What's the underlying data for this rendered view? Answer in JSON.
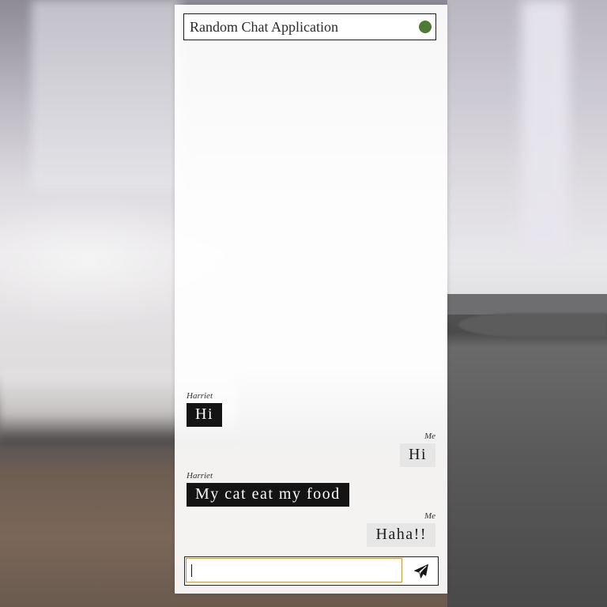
{
  "app": {
    "title": "Random Chat Application",
    "status_color": "#4e7a34"
  },
  "messages": [
    {
      "sender": "Harriet",
      "text": "Hi",
      "side": "left"
    },
    {
      "sender": "Me",
      "text": "Hi",
      "side": "right"
    },
    {
      "sender": "Harriet",
      "text": "My cat eat my food",
      "side": "left"
    },
    {
      "sender": "Me",
      "text": "Haha!!",
      "side": "right"
    }
  ],
  "composer": {
    "value": "",
    "send_icon": "paper-plane-icon"
  },
  "colors": {
    "incoming_bubble": "#141414",
    "outgoing_bubble": "#e6e6e6",
    "input_focus_border": "#c89a3e"
  }
}
